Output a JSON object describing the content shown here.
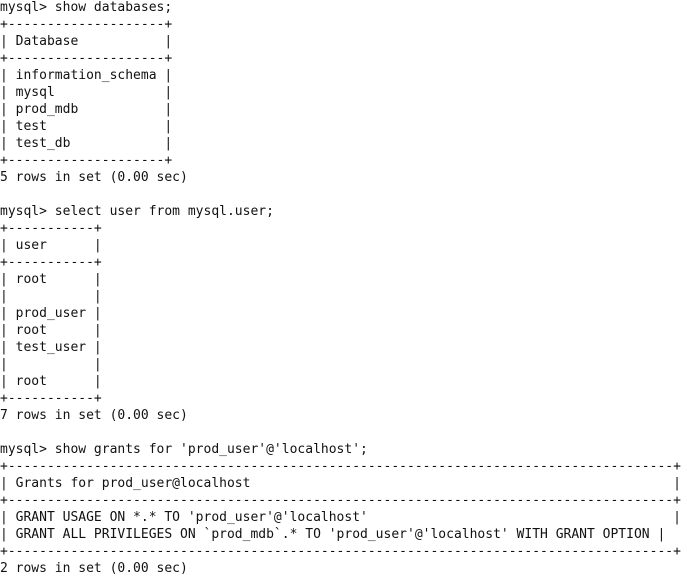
{
  "terminal": {
    "lines": [
      "mysql> show databases;",
      "+--------------------+",
      "| Database           |",
      "+--------------------+",
      "| information_schema |",
      "| mysql              |",
      "| prod_mdb           |",
      "| test               |",
      "| test_db            |",
      "+--------------------+",
      "5 rows in set (0.00 sec)",
      "",
      "mysql> select user from mysql.user;",
      "+-----------+",
      "| user      |",
      "+-----------+",
      "| root      |",
      "|           |",
      "| prod_user |",
      "| root      |",
      "| test_user |",
      "|           |",
      "| root      |",
      "+-----------+",
      "7 rows in set (0.00 sec)",
      "",
      "mysql> show grants for 'prod_user'@'localhost';",
      "+-------------------------------------------------------------------------------------+",
      "| Grants for prod_user@localhost                                                      |",
      "+-------------------------------------------------------------------------------------+",
      "| GRANT USAGE ON *.* TO 'prod_user'@'localhost'                                       |",
      "| GRANT ALL PRIVILEGES ON `prod_mdb`.* TO 'prod_user'@'localhost' WITH GRANT OPTION |",
      "+-------------------------------------------------------------------------------------+",
      "2 rows in set (0.00 sec)"
    ]
  }
}
